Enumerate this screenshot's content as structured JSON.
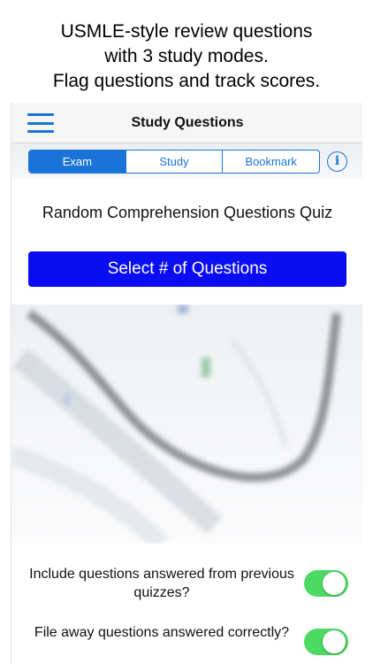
{
  "caption": {
    "line1": "USMLE-style review questions",
    "line2": "with 3 study modes.",
    "line3": "Flag questions and track scores."
  },
  "navbar": {
    "title": "Study Questions",
    "menu_icon": "hamburger-menu-icon"
  },
  "modes": {
    "tabs": [
      {
        "label": "Exam",
        "selected": true
      },
      {
        "label": "Study",
        "selected": false
      },
      {
        "label": "Bookmark",
        "selected": false
      }
    ],
    "info_icon": "info-icon",
    "info_glyph": "i"
  },
  "main": {
    "quiz_title": "Random Comprehension Questions Quiz",
    "select_button": "Select # of Questions",
    "hero_image": "stethoscope-image"
  },
  "settings": {
    "include_previous": {
      "label": "Include questions answered from previous quizzes?",
      "on": true
    },
    "file_away": {
      "label": "File away questions answered correctly?",
      "on": true
    }
  },
  "colors": {
    "accent": "#1a73d9",
    "button": "#0a0df2",
    "switch_on": "#4cd964"
  }
}
